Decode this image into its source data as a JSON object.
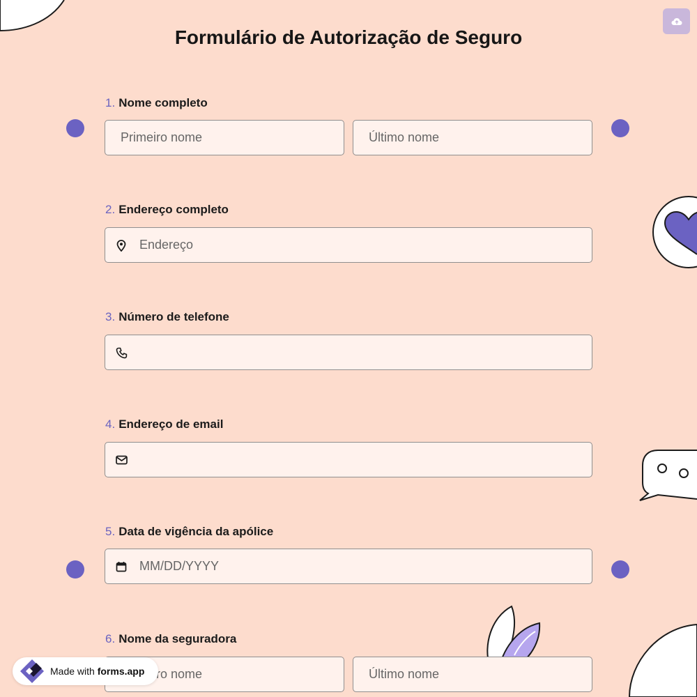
{
  "form": {
    "title": "Formulário de Autorização de Seguro",
    "questions": [
      {
        "number": "1.",
        "label": "Nome completo",
        "first_placeholder": "Primeiro nome",
        "last_placeholder": "Último nome"
      },
      {
        "number": "2.",
        "label": "Endereço completo",
        "placeholder": "Endereço",
        "icon": "map-pin-icon"
      },
      {
        "number": "3.",
        "label": "Número de telefone",
        "placeholder": "",
        "icon": "phone-icon"
      },
      {
        "number": "4.",
        "label": "Endereço de email",
        "placeholder": "",
        "icon": "mail-icon"
      },
      {
        "number": "5.",
        "label": "Data de vigência da apólice",
        "placeholder": "MM/DD/YYYY",
        "icon": "calendar-icon"
      },
      {
        "number": "6.",
        "label": "Nome da seguradora",
        "first_placeholder": "Primeiro nome",
        "last_placeholder": "Último nome"
      }
    ]
  },
  "badge": {
    "made_with": "Made with",
    "brand": "forms.app"
  },
  "toolbar": {
    "upload_icon": "cloud-upload-icon"
  },
  "colors": {
    "background": "#fddccd",
    "accent": "#6b62c2",
    "field_background": "#fff2ed",
    "upload_button": "#c9b7db"
  }
}
